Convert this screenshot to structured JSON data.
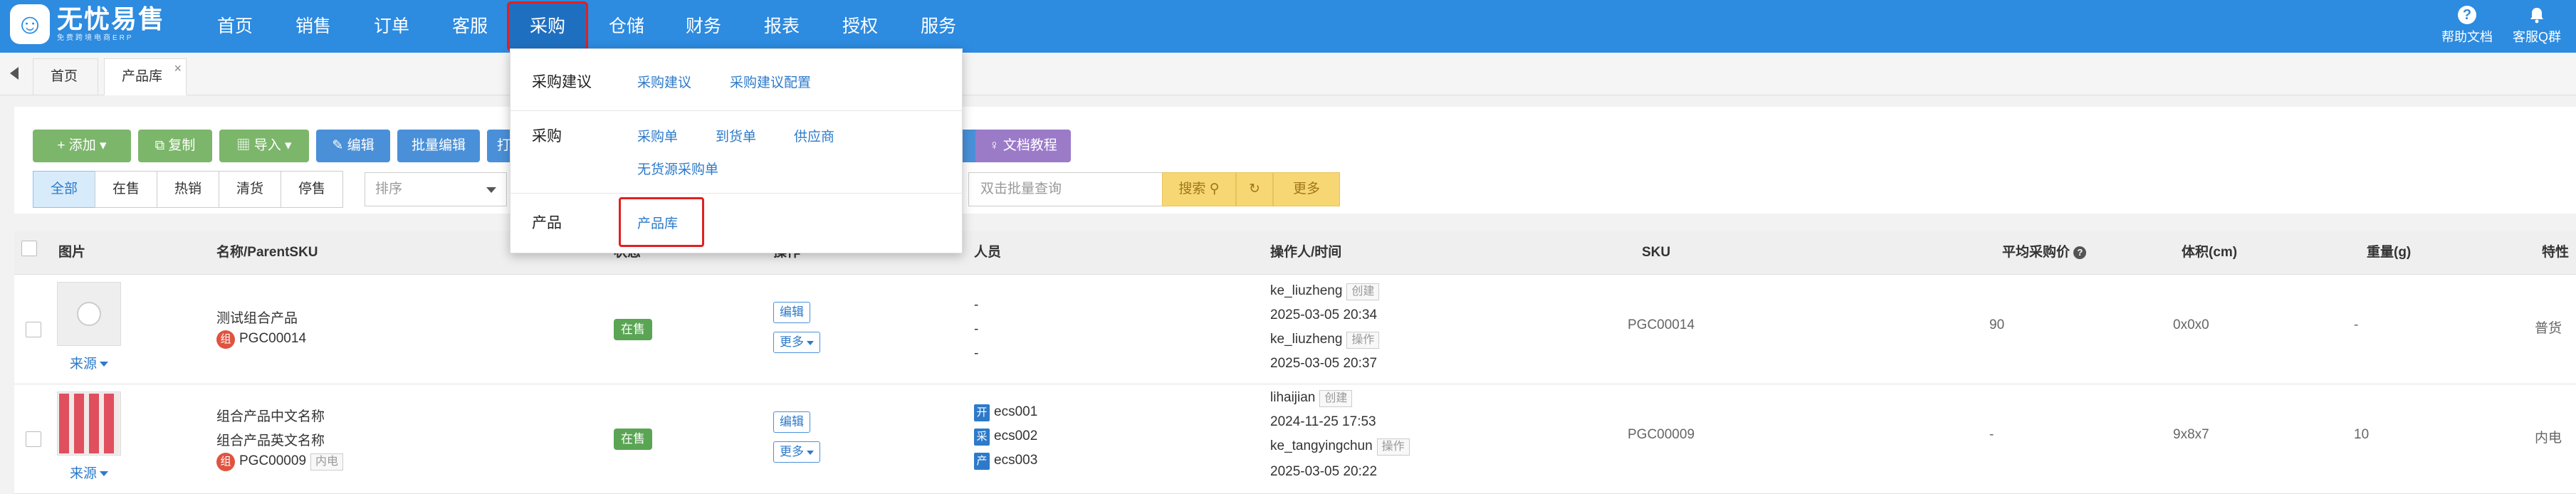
{
  "logo": {
    "mark": "☺",
    "title": "无忧易售",
    "subtitle": "免费跨境电商ERP"
  },
  "nav": [
    {
      "label": "首页"
    },
    {
      "label": "销售"
    },
    {
      "label": "订单"
    },
    {
      "label": "客服"
    },
    {
      "label": "采购"
    },
    {
      "label": "仓储"
    },
    {
      "label": "财务"
    },
    {
      "label": "报表"
    },
    {
      "label": "授权"
    },
    {
      "label": "服务"
    }
  ],
  "top_right": {
    "help": "帮助文档",
    "help_icon": "?",
    "service": "客服Q群",
    "service_icon": "bell-icon"
  },
  "tabs": [
    {
      "label": "首页"
    },
    {
      "label": "产品库"
    }
  ],
  "tab_close": "×",
  "toolbar": {
    "add": "+ 添加",
    "copy": "复制",
    "import": "导入",
    "edit": "编辑",
    "batch_edit": "批量编辑",
    "print": "打印",
    "doc": "文档教程"
  },
  "filters": [
    "全部",
    "在售",
    "热销",
    "清货",
    "停售"
  ],
  "sort_placeholder": "排序",
  "search_placeholder": "双击批量查询",
  "search_button": "搜索",
  "refresh_icon": "↻",
  "more_button": "更多",
  "table": {
    "headers": {
      "image": "图片",
      "name": "名称/ParentSKU",
      "status": "状态",
      "ops": "操作",
      "people": "人员",
      "operator_time": "操作人/时间",
      "sku": "SKU",
      "avg_price": "平均采购价",
      "volume": "体积(cm)",
      "weight": "重量(g)",
      "attr": "特性"
    },
    "rows": [
      {
        "source": "来源",
        "name": "测试组合产品",
        "zu": "组",
        "parent_sku": "PGC00014",
        "status": "在售",
        "edit": "编辑",
        "more": "更多",
        "people": [
          "-",
          "-",
          "-"
        ],
        "op1_user": "ke_liuzheng",
        "op1_tag": "创建",
        "op1_time": "2025-03-05 20:34",
        "op2_user": "ke_liuzheng",
        "op2_tag": "操作",
        "op2_time": "2025-03-05 20:37",
        "sku": "PGC00014",
        "avg_price": "90",
        "volume": "0x0x0",
        "weight": "-",
        "attr": "普货"
      },
      {
        "source": "来源",
        "name": "组合产品中文名称",
        "name_en": "组合产品英文名称",
        "zu": "组",
        "parent_sku": "PGC00009",
        "inner_tag": "内电",
        "status": "在售",
        "edit": "编辑",
        "more": "更多",
        "people": [
          {
            "role": "开",
            "name": "ecs001"
          },
          {
            "role": "采",
            "name": "ecs002"
          },
          {
            "role": "产",
            "name": "ecs003"
          }
        ],
        "op1_user": "lihaijian",
        "op1_tag": "创建",
        "op1_time": "2024-11-25 17:53",
        "op2_user": "ke_tangyingchun",
        "op2_tag": "操作",
        "op2_time": "2025-03-05 20:22",
        "sku": "PGC00009",
        "avg_price": "-",
        "volume": "9x8x7",
        "weight": "10",
        "attr": "内电"
      }
    ]
  },
  "dropdown": {
    "sections": [
      {
        "category": "采购建议",
        "links": [
          "采购建议",
          "采购建议配置"
        ]
      },
      {
        "category": "采购",
        "links": [
          "采购单",
          "到货单",
          "供应商",
          "无货源采购单"
        ]
      },
      {
        "category": "产品",
        "links": [
          "产品库"
        ]
      }
    ]
  },
  "colors": {
    "brand": "#2d8be0",
    "highlight": "#e02020",
    "success": "#5aa553"
  }
}
